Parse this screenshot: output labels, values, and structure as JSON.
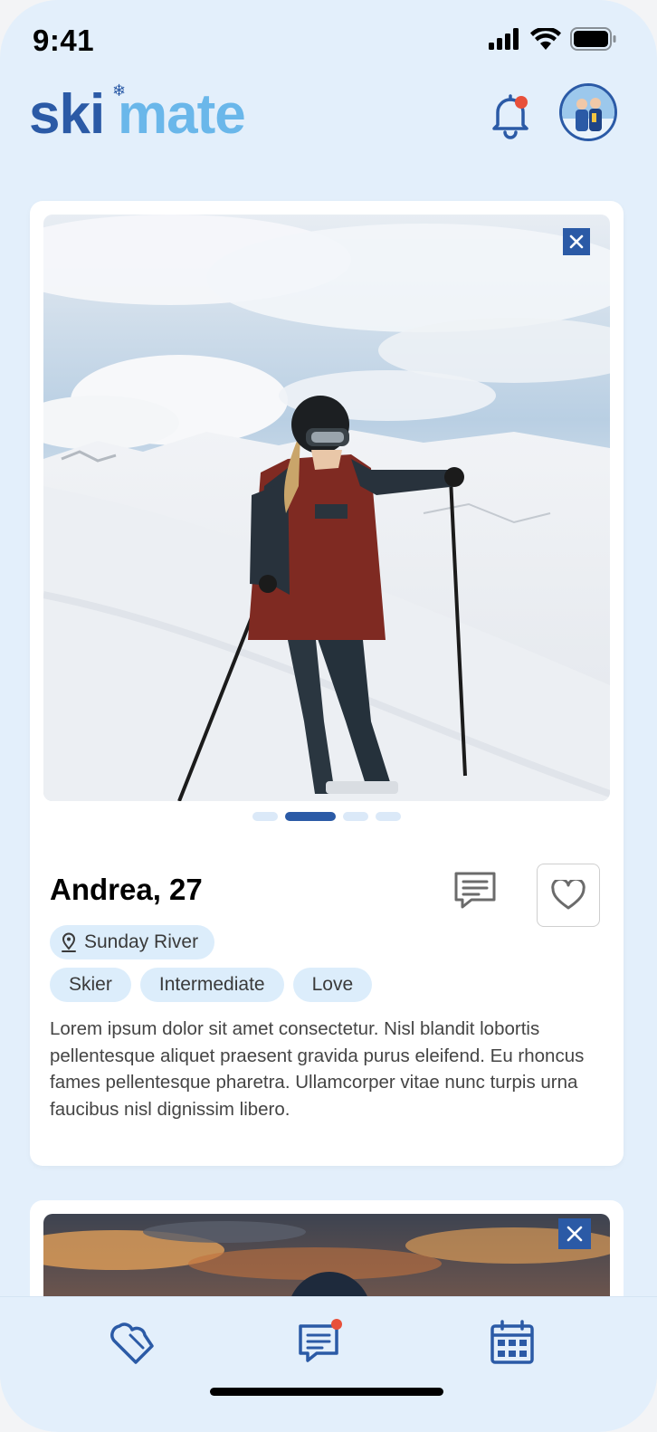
{
  "status_bar": {
    "time": "9:41"
  },
  "header": {
    "logo_left": "ski",
    "logo_right": "mate",
    "notification_dot_color": "#e8503a"
  },
  "profile": {
    "name_age": "Andrea, 27",
    "photo_index": 2,
    "photo_count": 4,
    "location": "Sunday River",
    "tags": [
      "Skier",
      "Intermediate",
      "Love"
    ],
    "bio": "Lorem ipsum dolor sit amet consectetur. Nisl blandit lobortis pellentesque aliquet praesent gravida purus eleifend. Eu rhoncus fames pellentesque pharetra. Ullamcorper vitae nunc turpis urna faucibus nisl dignissim libero."
  },
  "bottom_nav": {
    "items": [
      "matches-icon",
      "messages-icon",
      "calendar-icon"
    ],
    "messages_badge_color": "#e8503a"
  },
  "colors": {
    "primary": "#2b5aa6",
    "accent": "#6ab7ea",
    "background": "#e3effb",
    "chip": "#dcedfb"
  }
}
